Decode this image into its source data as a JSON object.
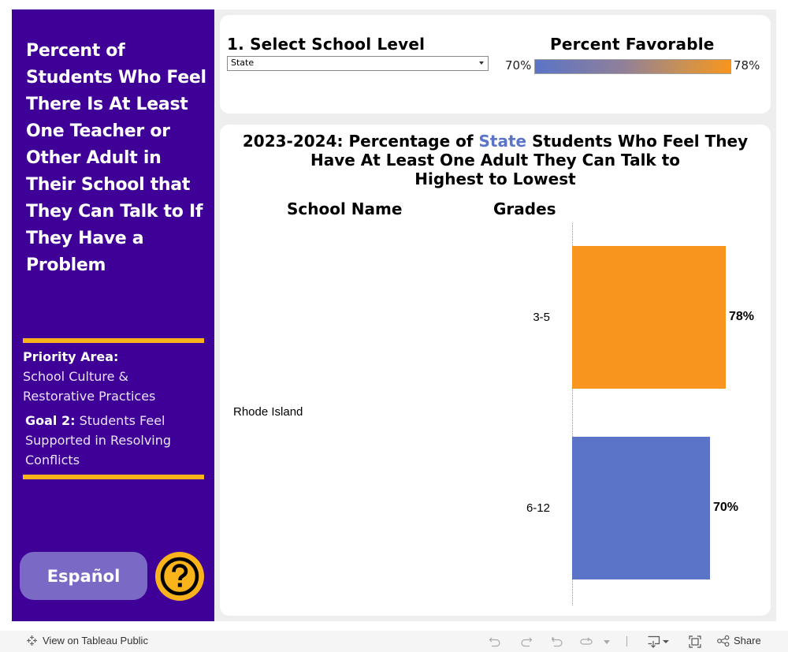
{
  "sidebar": {
    "title": "Percent of Students Who Feel There Is At Least One Teacher or Other Adult in Their School that They Can Talk to If They Have a Problem",
    "priority_label": "Priority Area:",
    "priority_text_1": "School Culture &",
    "priority_text_2": "Restorative Practices",
    "goal_label": "Goal 2:",
    "goal_text": "Students Feel Supported in Resolving Conflicts",
    "espanol_label": "Español",
    "help_icon": "question-circle-icon",
    "colors": {
      "background": "#3f0097",
      "accent": "#fbb31b",
      "button": "#7a6ac6"
    }
  },
  "filter": {
    "title": "1. Select School Level",
    "selected": "State"
  },
  "legend": {
    "title": "Percent Favorable",
    "min_label": "70%",
    "max_label": "78%",
    "min_color": "#5b74c7",
    "max_color": "#f7951e"
  },
  "chart_data": {
    "type": "bar",
    "orientation": "horizontal",
    "title_parts": [
      "2023-2024: Percentage of ",
      "State",
      " Students Who Feel They Have At Least One Adult They Can Talk to",
      "Highest to Lowest"
    ],
    "title": "2023-2024: Percentage of State Students Who Feel They Have At Least One Adult They Can Talk to Highest to Lowest",
    "column_headers": [
      "School Name",
      "Grades"
    ],
    "school": "Rhode Island",
    "categories": [
      "3-5",
      "6-12"
    ],
    "values": [
      78,
      70
    ],
    "value_labels": [
      "78%",
      "70%"
    ],
    "colors": [
      "#f7951e",
      "#5b74c7"
    ],
    "xlabel": "",
    "ylabel": "",
    "xlim": [
      0,
      80
    ],
    "grid": false,
    "legend": "top-right"
  },
  "footer": {
    "view_link": "View on Tableau Public",
    "share_label": "Share",
    "icons": [
      "undo-icon",
      "redo-icon",
      "revert-icon",
      "refresh-icon",
      "download-icon",
      "fullscreen-icon",
      "share-icon"
    ]
  }
}
